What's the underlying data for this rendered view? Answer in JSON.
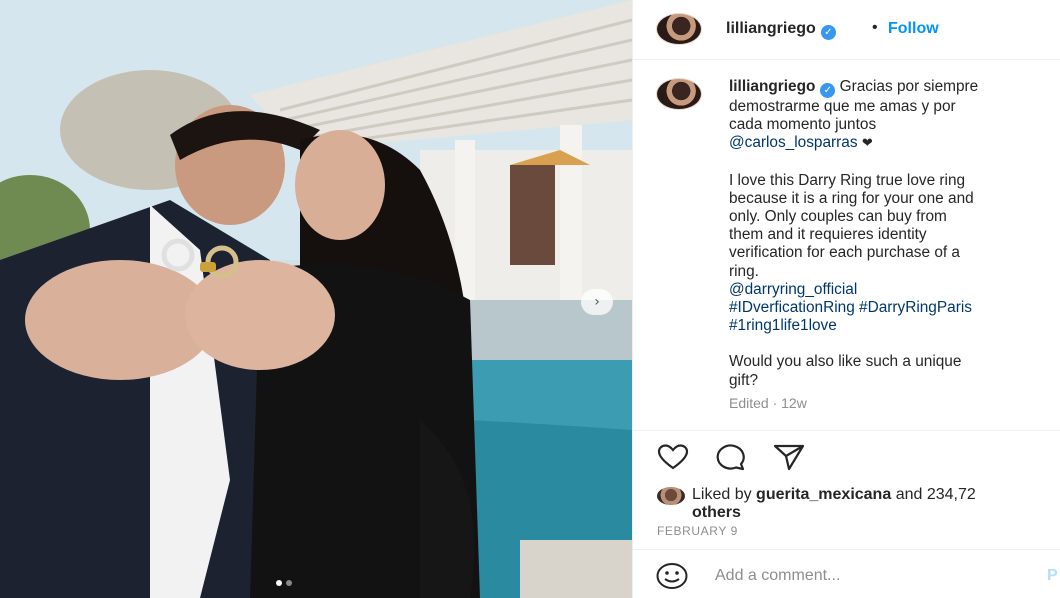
{
  "post": {
    "username": "lilliangriego",
    "follow_label": "Follow",
    "separator": "•",
    "verified_glyph": "✓"
  },
  "caption": {
    "username": "lilliangriego",
    "line1": "Gracias por siempre",
    "line2": "demostrarme que me amas y por",
    "line3": "cada momento juntos",
    "mention1": "@carlos_losparras",
    "heart": "❤",
    "para2_line1": "I love this Darry Ring true love ring",
    "para2_line2": "because it is a ring for your one and",
    "para2_line3": "only. Only couples can buy from",
    "para2_line4": "them and it requieres identity",
    "para2_line5": "verification for each purchase of a",
    "para2_line6": "ring.",
    "mention2": "@darryring_official",
    "hashtag1": "#IDverficationRing",
    "hashtag2": "#DarryRingParis",
    "hashtag3": "#1ring1life1love",
    "para3_line1": "Would you also like such a unique",
    "para3_line2": "gift?",
    "edited": "Edited · 12w"
  },
  "likes": {
    "prefix": "Liked by",
    "liker": "guerita_mexicana",
    "middle": "and 234,72",
    "suffix": "others"
  },
  "date": "FEBRUARY 9",
  "comment": {
    "placeholder": "Add a comment...",
    "post_label": "P"
  },
  "carousel": {
    "next_glyph": "›",
    "total_slides": 2,
    "active_slide": 1
  },
  "icons": [
    "heart-icon",
    "comment-icon",
    "share-icon",
    "emoji-icon",
    "verified-icon",
    "chevron-right-icon"
  ],
  "colors": {
    "follow": "#0095f6",
    "link": "#00376b",
    "verified": "#3897f0",
    "muted": "#8e8e8e"
  }
}
